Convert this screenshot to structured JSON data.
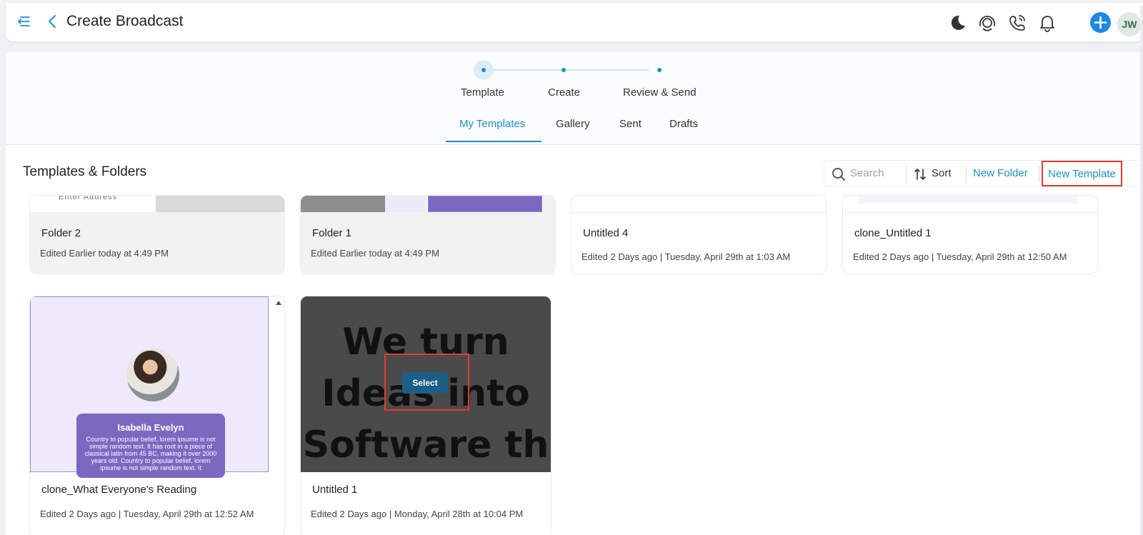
{
  "header": {
    "title": "Create Broadcast",
    "avatar_initials": "JW"
  },
  "stepper": {
    "steps": [
      {
        "label": "Template"
      },
      {
        "label": "Create"
      },
      {
        "label": "Review & Send"
      }
    ],
    "active_step": "Template"
  },
  "tabs": {
    "items": [
      {
        "label": "My Templates"
      },
      {
        "label": "Gallery"
      },
      {
        "label": "Sent"
      },
      {
        "label": "Drafts"
      }
    ],
    "active_tab": "My Templates"
  },
  "section": {
    "title": "Templates & Folders"
  },
  "toolbar": {
    "search_placeholder": "Search",
    "sort_label": "Sort",
    "new_folder_label": "New Folder",
    "new_template_label": "New Template"
  },
  "cards": {
    "row1": [
      {
        "name": "Folder 2",
        "meta": "Edited Earlier today at 4:49 PM",
        "thumb_text": "Enter Address"
      },
      {
        "name": "Folder 1",
        "meta": "Edited Earlier today at 4:49 PM"
      },
      {
        "name": "Untitled 4",
        "meta": "Edited 2 Days ago | Tuesday, April 29th at 1:03 AM"
      },
      {
        "name": "clone_Untitled 1",
        "meta": "Edited 2 Days ago | Tuesday, April 29th at 12:50 AM"
      }
    ],
    "row2": [
      {
        "name": "clone_What Everyone's Reading",
        "meta": "Edited 2 Days ago | Tuesday, April 29th at 12:52 AM",
        "profile_name": "Isabella Evelyn",
        "profile_text": "Country to popular belief, lorem ipsume is not simple random text. It has root in a piece of classical latin from 45 BC, making it over 2000 years old. Country to popular belief, lorem ipsume is not simple random text. It"
      },
      {
        "name": "Untitled 1",
        "meta": "Edited 2 Days ago | Monday, April 28th at 10:04 PM",
        "thumb_text": "We turn Ideas into Software th",
        "select_label": "Select"
      }
    ]
  },
  "colors": {
    "accent": "#1e8fc6",
    "highlight": "#e53935",
    "profile_card": "#7a68c1",
    "select_button": "#1b5f86"
  },
  "icons": [
    "menu-icon",
    "chevron-left-icon",
    "moon-icon",
    "support-agent-icon",
    "phone-call-icon",
    "bell-icon",
    "plus-icon",
    "search-icon",
    "sort-icon"
  ]
}
